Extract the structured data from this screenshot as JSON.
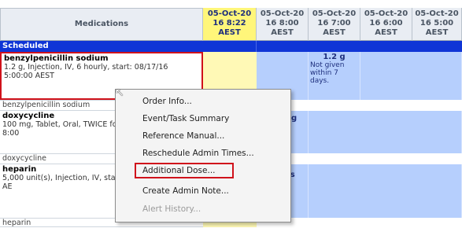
{
  "header": {
    "medications_label": "Medications",
    "times": [
      "05-Oct-20\n16 8:22\nAEST",
      "05-Oct-20\n16 8:00\nAEST",
      "05-Oct-20\n16 7:00\nAEST",
      "05-Oct-20\n16 6:00\nAEST",
      "05-Oct-20\n16 5:00\nAEST"
    ]
  },
  "section": {
    "label": "Scheduled"
  },
  "rows": [
    {
      "name": "benzylpenicillin sodium",
      "detail": "1.2 g, Injection, IV, 6 hourly, start: 08/17/16 5:00:00 AEST",
      "sub_label": "benzylpenicillin sodium",
      "dose_value": "1.2 g",
      "dose_status": "Not given within 7 days."
    },
    {
      "name": "doxycycline",
      "detail": "100 mg, Tablet, Oral, TWICE food), start: 08/17/16 8:00",
      "sub_label": "doxycycline",
      "partial_cell": "g"
    },
    {
      "name": "heparin",
      "detail": "5,000 unit(s), Injection, IV, start: 08/17/16 8:00:00 AE",
      "sub_label": "heparin",
      "partial_cell": "it(s"
    }
  ],
  "context_menu": {
    "items": [
      {
        "label": "Order Info...",
        "enabled": true
      },
      {
        "label": "Event/Task Summary",
        "enabled": true
      },
      {
        "label": "Reference Manual...",
        "enabled": true
      },
      {
        "label": "Reschedule Admin Times...",
        "enabled": true
      },
      {
        "label": "Additional Dose...",
        "enabled": true,
        "highlighted": true
      },
      {
        "label": "Create Admin Note...",
        "enabled": true
      },
      {
        "label": "Alert History...",
        "enabled": false
      }
    ]
  },
  "colors": {
    "scheduled_bar": "#0f35d6",
    "highlight_column": "#fff67a",
    "cell_blue": "#b6cffd",
    "selection_red": "#d0121b"
  }
}
